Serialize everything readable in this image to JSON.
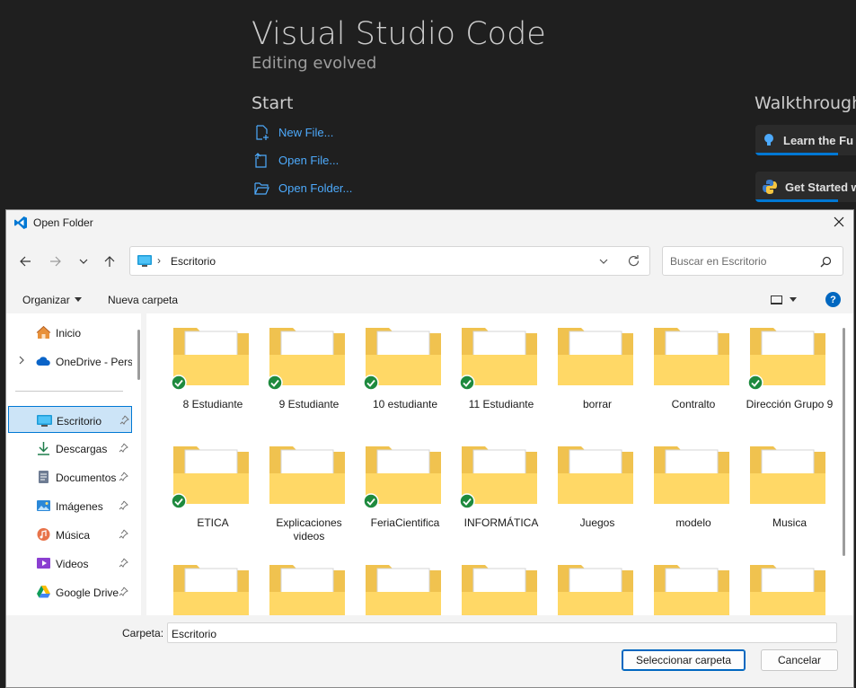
{
  "vscode": {
    "title": "Visual Studio Code",
    "subtitle": "Editing evolved",
    "start_heading": "Start",
    "walkthroughs_heading": "Walkthroughs",
    "start_items": [
      "New File...",
      "Open File...",
      "Open Folder..."
    ],
    "walkthroughs": [
      "Learn the Fu",
      "Get Started w"
    ]
  },
  "dialog": {
    "title": "Open Folder",
    "path": "Escritorio",
    "search_placeholder": "Buscar en Escritorio",
    "organize": "Organizar",
    "new_folder": "Nueva carpeta",
    "sidebar": [
      {
        "label": "Inicio",
        "icon": "home-icon"
      },
      {
        "label": "OneDrive - Pers",
        "icon": "onedrive-icon"
      },
      {
        "label": "Escritorio",
        "icon": "desktop-icon"
      },
      {
        "label": "Descargas",
        "icon": "downloads-icon"
      },
      {
        "label": "Documentos",
        "icon": "documents-icon"
      },
      {
        "label": "Imágenes",
        "icon": "pictures-icon"
      },
      {
        "label": "Música",
        "icon": "music-icon"
      },
      {
        "label": "Videos",
        "icon": "videos-icon"
      },
      {
        "label": "Google Drive",
        "icon": "google-drive-icon"
      }
    ],
    "folders": [
      {
        "name": "8 Estudiante",
        "synced": true
      },
      {
        "name": "9 Estudiante",
        "synced": true
      },
      {
        "name": "10 estudiante",
        "synced": true
      },
      {
        "name": "11 Estudiante",
        "synced": true
      },
      {
        "name": "borrar",
        "synced": false
      },
      {
        "name": "Contralto",
        "synced": false
      },
      {
        "name": "Dirección Grupo 9",
        "synced": true
      },
      {
        "name": "ETICA",
        "synced": true
      },
      {
        "name": "Explicaciones videos",
        "synced": false
      },
      {
        "name": "FeriaCientifica",
        "synced": true
      },
      {
        "name": "INFORMÁTICA",
        "synced": true
      },
      {
        "name": "Juegos",
        "synced": false
      },
      {
        "name": "modelo",
        "synced": false
      },
      {
        "name": "Musica",
        "synced": false
      },
      {
        "name": "",
        "synced": false
      },
      {
        "name": "",
        "synced": false
      },
      {
        "name": "",
        "synced": false
      },
      {
        "name": "",
        "synced": false
      },
      {
        "name": "",
        "synced": false
      },
      {
        "name": "",
        "synced": false
      },
      {
        "name": "",
        "synced": false
      }
    ],
    "folder_label": "Carpeta:",
    "folder_value": "Escritorio",
    "select_button": "Seleccionar carpeta",
    "cancel_button": "Cancelar",
    "help_glyph": "?"
  },
  "colors": {
    "accent": "#0078d4",
    "link": "#4daafc",
    "folder_back": "#f0c24f",
    "folder_front": "#ffd866",
    "synced": "#1e8a3e"
  }
}
